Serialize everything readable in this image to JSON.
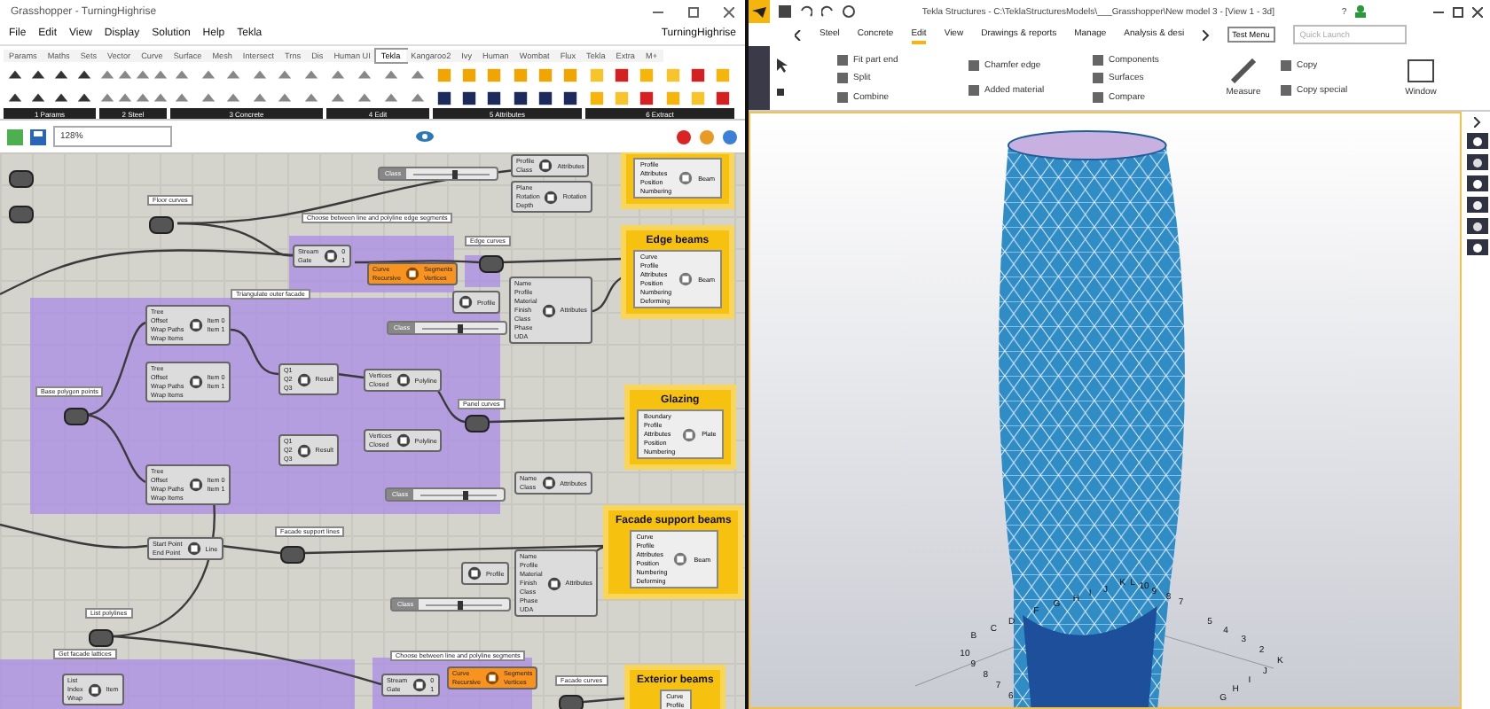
{
  "grasshopper": {
    "title": "Grasshopper - TurningHighrise",
    "menu": [
      "File",
      "Edit",
      "View",
      "Display",
      "Solution",
      "Help",
      "Tekla"
    ],
    "document": "TurningHighrise",
    "tabs": [
      {
        "label": "Params",
        "selected": false
      },
      {
        "label": "Maths",
        "selected": false
      },
      {
        "label": "Sets",
        "selected": false
      },
      {
        "label": "Vector",
        "selected": false
      },
      {
        "label": "Curve",
        "selected": false
      },
      {
        "label": "Surface",
        "selected": false
      },
      {
        "label": "Mesh",
        "selected": false
      },
      {
        "label": "Intersect",
        "selected": false
      },
      {
        "label": "Trns",
        "selected": false
      },
      {
        "label": "Dis",
        "selected": false
      },
      {
        "label": "Human UI",
        "selected": false
      },
      {
        "label": "Tekla",
        "selected": true
      },
      {
        "label": "Kangaroo2",
        "selected": false
      },
      {
        "label": "Ivy",
        "selected": false
      },
      {
        "label": "Human",
        "selected": false
      },
      {
        "label": "Wombat",
        "selected": false
      },
      {
        "label": "Flux",
        "selected": false
      },
      {
        "label": "Tekla",
        "selected": false
      },
      {
        "label": "Extra",
        "selected": false
      },
      {
        "label": "M+",
        "selected": false
      }
    ],
    "panel_groups": [
      "1 Params",
      "2 Steel",
      "3 Concrete",
      "4 Edit",
      "5 Attributes",
      "6 Extract"
    ],
    "zoom": "128%",
    "canvas": {
      "groups": [
        {
          "kind": "purple"
        },
        {
          "kind": "purple"
        },
        {
          "kind": "purple"
        },
        {
          "kind": "purple"
        },
        {
          "kind": "purple"
        }
      ],
      "scribbles": [
        "Floor curves",
        "Choose between line and polyline edge segments",
        "Edge curves",
        "Triangulate outer facade",
        "Base polygon points",
        "Panel curves",
        "Facade support lines",
        "List polylines",
        "Get facade lattices",
        "Choose between line and polyline segments",
        "Facade curves"
      ],
      "nodes": [
        {
          "kind": "component",
          "inputs": [
            "Profile",
            "Class"
          ],
          "name": "Attributes"
        },
        {
          "kind": "component",
          "inputs": [
            "Plane",
            "Rotation",
            "Depth"
          ],
          "name": "Rotation"
        },
        {
          "kind": "component",
          "inputs": [
            "Stream",
            "Gate"
          ],
          "outputs": [
            "0",
            "1"
          ]
        },
        {
          "kind": "orange",
          "inputs": [
            "Curve",
            "Recursive"
          ],
          "outputs": [
            "Segments",
            "Vertices"
          ]
        },
        {
          "kind": "component",
          "inputs": [
            "Name",
            "Profile",
            "Material",
            "Finish",
            "Class",
            "Phase",
            "UDA"
          ],
          "name": "Attributes"
        },
        {
          "kind": "component",
          "inputs": [
            "Tree",
            "Offset",
            "Wrap Paths",
            "Wrap Items"
          ],
          "outputs": [
            "Item 0",
            "Item 1"
          ]
        },
        {
          "kind": "component",
          "inputs": [
            "Tree",
            "Offset",
            "Wrap Paths",
            "Wrap Items"
          ],
          "outputs": [
            "Item 0",
            "Item 1"
          ]
        },
        {
          "kind": "component",
          "inputs": [
            "Tree",
            "Offset",
            "Wrap Paths",
            "Wrap Items"
          ],
          "outputs": [
            "Item 0",
            "Item 1"
          ]
        },
        {
          "kind": "component",
          "inputs": [
            "Q1",
            "Q2",
            "Q3"
          ],
          "name": "Result"
        },
        {
          "kind": "component",
          "inputs": [
            "Q1",
            "Q2",
            "Q3"
          ],
          "name": "Result"
        },
        {
          "kind": "component",
          "inputs": [
            "Vertices",
            "Closed"
          ],
          "name": "Polyline"
        },
        {
          "kind": "component",
          "inputs": [
            "Vertices",
            "Closed"
          ],
          "name": "Polyline"
        },
        {
          "kind": "component",
          "inputs": [
            "Name",
            "Class"
          ],
          "name": "Attributes"
        },
        {
          "kind": "component",
          "inputs": [
            "Start Point",
            "End Point"
          ],
          "name": "Line"
        },
        {
          "kind": "component",
          "inputs": [
            "Name",
            "Profile",
            "Material",
            "Finish",
            "Class",
            "Phase",
            "UDA"
          ],
          "name": "Attributes"
        },
        {
          "kind": "component",
          "inputs": [
            "List",
            "Index",
            "Wrap"
          ],
          "name": "Item"
        },
        {
          "kind": "component",
          "inputs": [
            "Stream",
            "Gate"
          ],
          "outputs": [
            "0",
            "1"
          ]
        },
        {
          "kind": "orange",
          "inputs": [
            "Curve",
            "Recursive"
          ],
          "outputs": [
            "Segments",
            "Vertices"
          ]
        },
        {
          "kind": "slider",
          "label": "Class",
          "level": 0.55
        },
        {
          "kind": "slider",
          "label": "Class",
          "level": 0.5
        },
        {
          "kind": "slider",
          "label": "Class",
          "level": 0.6
        },
        {
          "kind": "slider",
          "label": "Class",
          "level": 0.45
        },
        {
          "kind": "component",
          "name": "Profile"
        },
        {
          "kind": "component",
          "name": "Profile"
        }
      ],
      "outputs": [
        {
          "inputs": [
            "Profile",
            "Attributes",
            "Position",
            "Numbering"
          ],
          "component": "Beam"
        },
        {
          "title": "Edge beams",
          "inputs": [
            "Curve",
            "Profile",
            "Attributes",
            "Position",
            "Numbering",
            "Deforming"
          ],
          "component": "Beam"
        },
        {
          "title": "Glazing",
          "inputs": [
            "Boundary",
            "Profile",
            "Attributes",
            "Position",
            "Numbering"
          ],
          "component": "Plate"
        },
        {
          "title": "Facade support beams",
          "inputs": [
            "Curve",
            "Profile",
            "Attributes",
            "Position",
            "Numbering",
            "Deforming"
          ],
          "component": "Beam"
        },
        {
          "title": "Exterior beams",
          "inputs": [
            "Curve",
            "Profile"
          ]
        }
      ]
    }
  },
  "tekla": {
    "title": "Tekla Structures - C:\\TeklaStructuresModels\\___Grasshopper\\New model 3 - [View 1 - 3d]",
    "help": "?",
    "tabs": [
      {
        "label": "Steel",
        "selected": false
      },
      {
        "label": "Concrete",
        "selected": false
      },
      {
        "label": "Edit",
        "selected": true
      },
      {
        "label": "View",
        "selected": false
      },
      {
        "label": "Drawings & reports",
        "selected": false
      },
      {
        "label": "Manage",
        "selected": false
      },
      {
        "label": "Analysis & desi",
        "selected": false
      }
    ],
    "test_menu": "Test Menu",
    "search": {
      "placeholder": "Quick Launch"
    },
    "ribbon": [
      {
        "kind": "stack",
        "items": [
          "Fit part end",
          "Split",
          "Combine"
        ]
      },
      {
        "kind": "stack",
        "items": [
          "Chamfer edge",
          "Added material"
        ]
      },
      {
        "kind": "stack",
        "items": [
          "Components",
          "Surfaces",
          "Compare"
        ]
      },
      {
        "kind": "big",
        "items": [
          "Measure"
        ]
      },
      {
        "kind": "stack",
        "items": [
          "Copy",
          "Copy special"
        ]
      },
      {
        "kind": "big",
        "items": [
          "Window"
        ]
      }
    ],
    "grid_labels": [
      "D",
      "C",
      "B",
      "10",
      "9",
      "8",
      "7",
      "6",
      "5",
      "4",
      "3",
      "2",
      "K",
      "J",
      "I",
      "H",
      "G",
      "F",
      "G",
      "H",
      "I",
      "J",
      "K",
      "L",
      "10",
      "9",
      "8",
      "7"
    ]
  }
}
